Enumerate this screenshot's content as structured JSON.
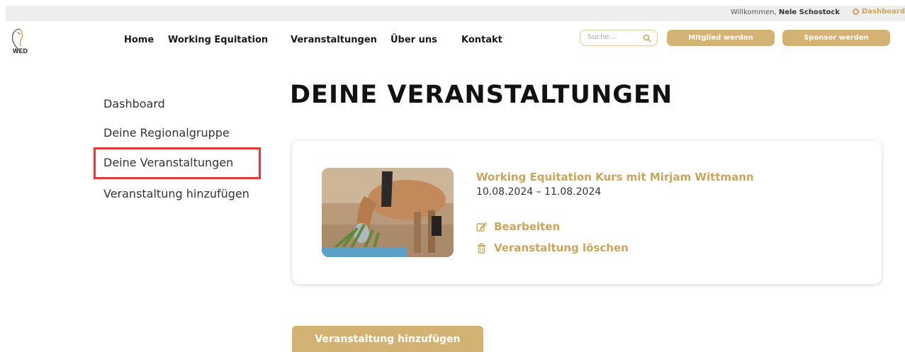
{
  "topbar": {
    "welcome_prefix": "Willkommen,",
    "user_name": "Nele Schostock",
    "dashboard_link": "Dashboard"
  },
  "logo": {
    "text": "WED"
  },
  "nav": {
    "items": [
      {
        "label": "Home"
      },
      {
        "label": "Working Equitation"
      },
      {
        "label": "Veranstaltungen"
      },
      {
        "label": "Über uns"
      },
      {
        "label": "Kontakt"
      }
    ],
    "search_placeholder": "Suche...",
    "member_button": "Mitglied werden",
    "sponsor_button": "Sponsor werden"
  },
  "sidebar": {
    "items": [
      {
        "label": "Dashboard"
      },
      {
        "label": "Deine Regionalgruppe"
      },
      {
        "label": "Deine Veranstaltungen",
        "active": true
      },
      {
        "label": "Veranstaltung hinzufügen"
      }
    ]
  },
  "main": {
    "title": "DEINE VERANSTALTUNGEN",
    "events": [
      {
        "title": "Working Equitation Kurs mit Mirjam Wittmann",
        "dates": "10.08.2024 – 11.08.2024",
        "edit_label": "Bearbeiten",
        "delete_label": "Veranstaltung löschen"
      }
    ],
    "add_button": "Veranstaltung hinzufügen"
  },
  "colors": {
    "accent": "#c9a560",
    "button": "#d4b273",
    "highlight": "#e53935"
  },
  "icons": {
    "search": "search-icon",
    "edit": "edit-icon",
    "delete": "trash-icon",
    "dashboard": "circle-icon"
  }
}
